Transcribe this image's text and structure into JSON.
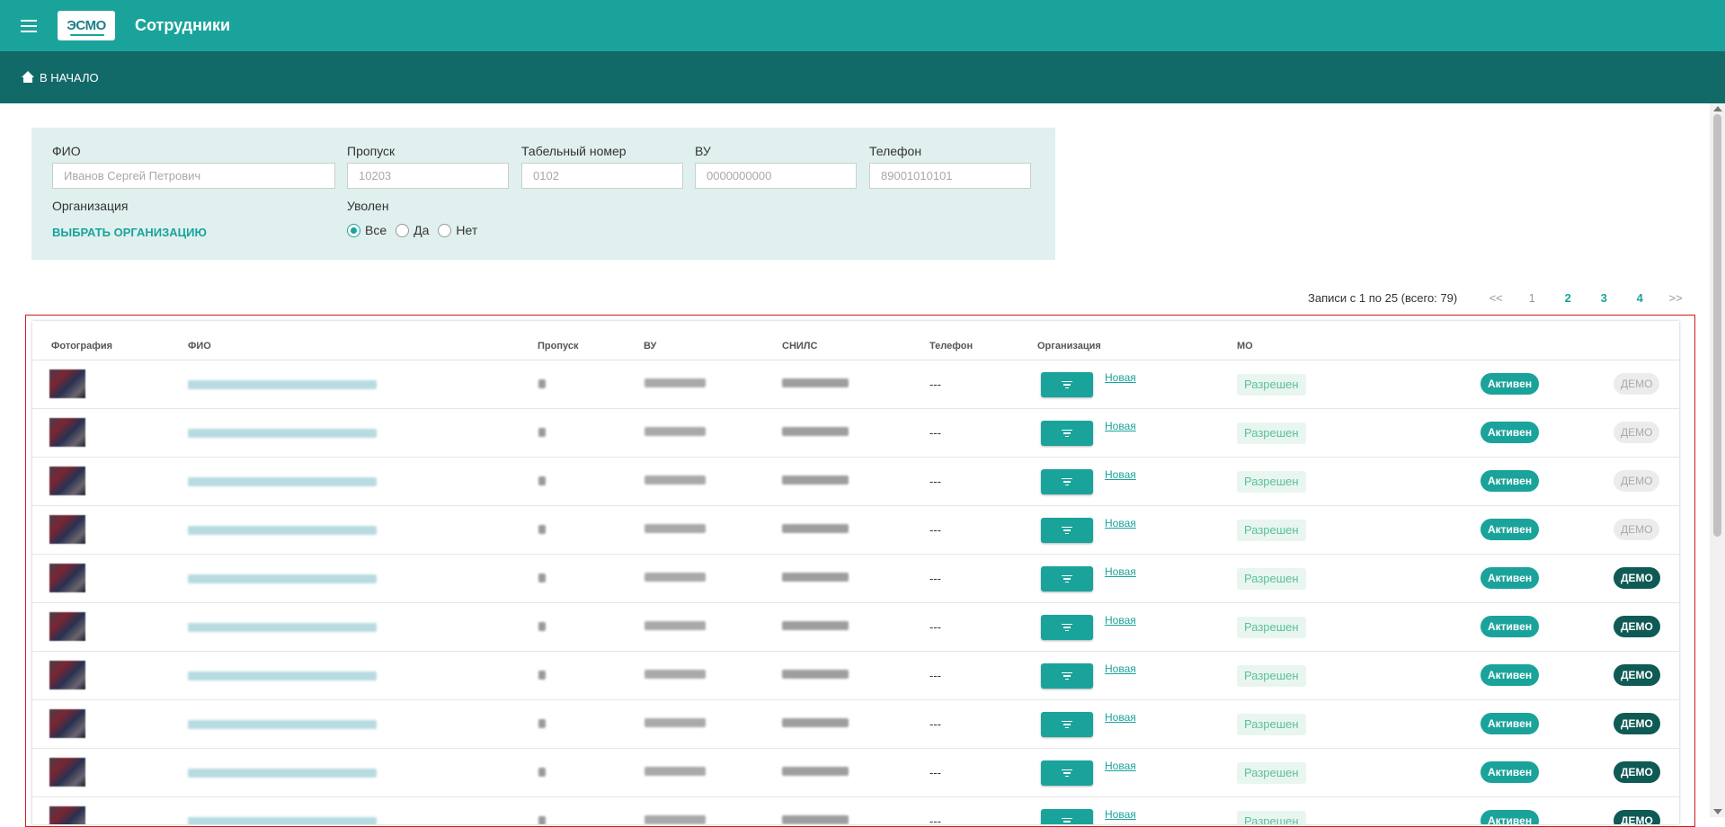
{
  "header": {
    "menu_icon": "hamburger-menu-icon",
    "logo_text": "ЭСМО",
    "title": "Сотрудники",
    "color": "#1aa39b"
  },
  "breadcrumb": {
    "home_icon": "home-icon",
    "label": "В НАЧАЛО",
    "color": "#126a68"
  },
  "filters": {
    "fio": {
      "label": "ФИО",
      "placeholder": "Иванов Сергей Петрович"
    },
    "pass": {
      "label": "Пропуск",
      "placeholder": "10203"
    },
    "tab": {
      "label": "Табельный номер",
      "placeholder": "0102"
    },
    "vu": {
      "label": "ВУ",
      "placeholder": "0000000000"
    },
    "phone": {
      "label": "Телефон",
      "placeholder": "89001010101"
    },
    "org": {
      "label": "Организация",
      "link": "ВЫБРАТЬ ОРГАНИЗАЦИЮ"
    },
    "fired": {
      "label": "Уволен",
      "options": [
        "Все",
        "Да",
        "Нет"
      ],
      "selected": "Все"
    }
  },
  "pager": {
    "info": "Записи с 1 по 25 (всего: 79)",
    "first": "<<",
    "pages": [
      "1",
      "2",
      "3",
      "4"
    ],
    "current": "1",
    "last": ">>"
  },
  "table": {
    "columns": [
      "Фотография",
      "ФИО",
      "Пропуск",
      "ВУ",
      "СНИЛС",
      "Телефон",
      "Организация",
      "МО"
    ],
    "rows": [
      {
        "phone": "---",
        "org_link": "Новая",
        "mo": "Разрешен",
        "status": "Активен",
        "demo": "ДЕМО",
        "demo_active": false
      },
      {
        "phone": "---",
        "org_link": "Новая",
        "mo": "Разрешен",
        "status": "Активен",
        "demo": "ДЕМО",
        "demo_active": false
      },
      {
        "phone": "---",
        "org_link": "Новая",
        "mo": "Разрешен",
        "status": "Активен",
        "demo": "ДЕМО",
        "demo_active": false
      },
      {
        "phone": "---",
        "org_link": "Новая",
        "mo": "Разрешен",
        "status": "Активен",
        "demo": "ДЕМО",
        "demo_active": false
      },
      {
        "phone": "---",
        "org_link": "Новая",
        "mo": "Разрешен",
        "status": "Активен",
        "demo": "ДЕМО",
        "demo_active": true
      },
      {
        "phone": "---",
        "org_link": "Новая",
        "mo": "Разрешен",
        "status": "Активен",
        "demo": "ДЕМО",
        "demo_active": true
      },
      {
        "phone": "---",
        "org_link": "Новая",
        "mo": "Разрешен",
        "status": "Активен",
        "demo": "ДЕМО",
        "demo_active": true
      },
      {
        "phone": "---",
        "org_link": "Новая",
        "mo": "Разрешен",
        "status": "Активен",
        "demo": "ДЕМО",
        "demo_active": true
      },
      {
        "phone": "---",
        "org_link": "Новая",
        "mo": "Разрешен",
        "status": "Активен",
        "demo": "ДЕМО",
        "demo_active": true
      },
      {
        "phone": "---",
        "org_link": "Новая",
        "mo": "Разрешен",
        "status": "Активен",
        "demo": "ДЕМО",
        "demo_active": true
      }
    ],
    "filter_icon": "filter-icon"
  },
  "colors": {
    "accent": "#1aa39b",
    "dark_accent": "#126a68",
    "highlight_border": "#d0191e"
  }
}
